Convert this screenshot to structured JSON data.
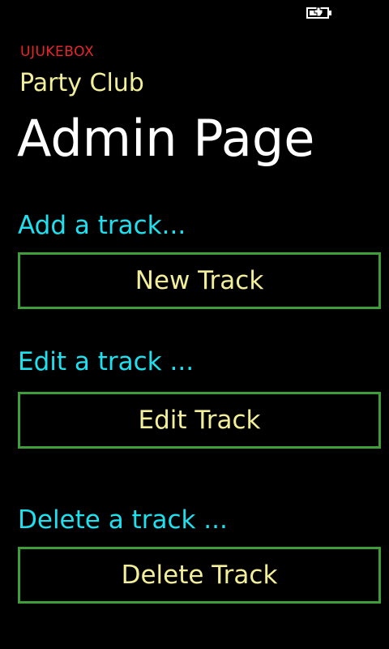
{
  "status_bar": {
    "battery_icon": "battery-charging-icon"
  },
  "header": {
    "app_name": "UJUKEBOX",
    "subtitle": "Party Club",
    "title": "Admin Page"
  },
  "sections": [
    {
      "label": "Add a track...",
      "button_label": "New Track"
    },
    {
      "label": "Edit a track ...",
      "button_label": "Edit Track"
    },
    {
      "label": "Delete a track ...",
      "button_label": "Delete Track"
    }
  ],
  "colors": {
    "background": "#000000",
    "app_name": "#e8262c",
    "subtitle": "#f2ee9a",
    "title": "#ffffff",
    "section_label": "#1fe0ee",
    "button_text": "#f2ee9a",
    "button_border": "#3f9d3a"
  }
}
